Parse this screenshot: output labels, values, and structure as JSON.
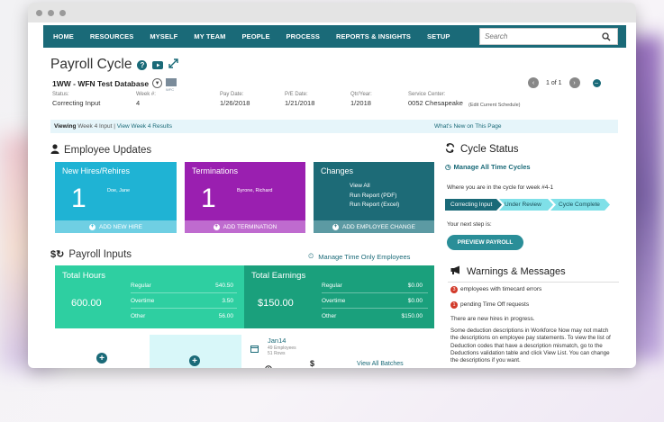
{
  "nav": {
    "items": [
      "HOME",
      "RESOURCES",
      "MYSELF",
      "MY TEAM",
      "PEOPLE",
      "PROCESS",
      "REPORTS & INSIGHTS",
      "SETUP"
    ],
    "search_placeholder": "Search"
  },
  "page": {
    "title": "Payroll Cycle",
    "database": "1WW - WFN Test Database",
    "db_tag": "WFC"
  },
  "meta": {
    "status_label": "Status:",
    "status_value": "Correcting Input",
    "week_label": "Week #:",
    "week_value": "4",
    "pay_date_label": "Pay Date:",
    "pay_date_value": "1/26/2018",
    "pe_date_label": "P/E Date:",
    "pe_date_value": "1/21/2018",
    "qtr_label": "Qtr/Year:",
    "qtr_value": "1/2018",
    "service_label": "Service Center:",
    "service_value": "0052  Chesapeake",
    "edit_schedule": "(Edit Current Schedule)"
  },
  "pager": {
    "text": "1 of 1"
  },
  "viewing": {
    "label": "Viewing",
    "current": "Week 4 Input",
    "sep": "|",
    "other": "View Week 4 Results",
    "whats_new": "What's New on This Page"
  },
  "employee_updates": {
    "heading": "Employee Updates",
    "new_hires": {
      "title": "New Hires/Rehires",
      "count": "1",
      "name": "Doe, Jane",
      "action": "ADD NEW HIRE"
    },
    "terminations": {
      "title": "Terminations",
      "count": "1",
      "name": "Byrone, Richard",
      "action": "ADD TERMINATION"
    },
    "changes": {
      "title": "Changes",
      "links": [
        "View All",
        "Run Report (PDF)",
        "Run Report (Excel)"
      ],
      "action": "ADD EMPLOYEE CHANGE"
    }
  },
  "payroll_inputs": {
    "heading": "Payroll Inputs",
    "manage_link": "Manage Time Only Employees",
    "hours": {
      "title": "Total Hours",
      "total": "600.00",
      "rows": [
        {
          "label": "Regular",
          "value": "540.50"
        },
        {
          "label": "Overtime",
          "value": "3.50"
        },
        {
          "label": "Other",
          "value": "56.00"
        }
      ]
    },
    "earnings": {
      "title": "Total Earnings",
      "total": "$150.00",
      "rows": [
        {
          "label": "Regular",
          "value": "$0.00"
        },
        {
          "label": "Overtime",
          "value": "$0.00"
        },
        {
          "label": "Other",
          "value": "$150.00"
        }
      ]
    }
  },
  "batches": {
    "name": "Jan14",
    "employees": "49 Employees",
    "rows": "51 Rows",
    "view_all": "View All Batches"
  },
  "cycle_status": {
    "heading": "Cycle Status",
    "manage_link": "Manage All Time Cycles",
    "where_text": "Where you are in the cycle for week #4-1",
    "steps": [
      "Correcting Input",
      "Under Review",
      "Cycle Complete"
    ],
    "next_step": "Your next step is:",
    "button": "PREVIEW PAYROLL"
  },
  "warnings": {
    "heading": "Warnings & Messages",
    "items": [
      {
        "count": "3",
        "text": "employees with timecard errors"
      },
      {
        "count": "1",
        "text": "pending Time Off requests"
      }
    ],
    "new_hires": "There are new hires in progress.",
    "deduction_text": "Some deduction descriptions in Workforce Now may not match the descriptions on employee pay statements. To view the list of Deduction codes that have a description mismatch, go to the Deductions validation table and click View List. You can change the descriptions if you want."
  },
  "colors": {
    "nav": "#1a6a78",
    "blue_tile": "#1fb3d4",
    "purple_tile": "#9a1fb0",
    "teal_tile": "#1d6b77",
    "green_hours": "#2ecfa1",
    "green_earnings": "#1aa07c",
    "step_active": "#1a6a78",
    "step_inactive": "#7fe0e8"
  }
}
